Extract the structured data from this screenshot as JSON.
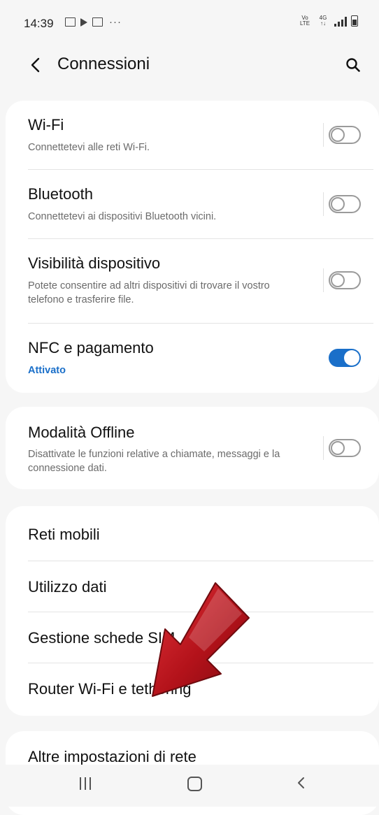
{
  "status_bar": {
    "time": "14:39",
    "dots": "···",
    "lte_label": "VoLTE"
  },
  "header": {
    "title": "Connessioni",
    "back_icon": "chevron-left-icon",
    "search_icon": "search-icon"
  },
  "card1": {
    "items": [
      {
        "title": "Wi-Fi",
        "subtitle": "Connettetevi alle reti Wi-Fi.",
        "toggle": "off"
      },
      {
        "title": "Bluetooth",
        "subtitle": "Connettetevi ai dispositivi Bluetooth vicini.",
        "toggle": "off"
      },
      {
        "title": "Visibilità dispositivo",
        "subtitle": "Potete consentire ad altri dispositivi di trovare il vostro telefono e trasferire file.",
        "toggle": "off"
      },
      {
        "title": "NFC e pagamento",
        "subtitle": "Attivato",
        "toggle": "on"
      }
    ]
  },
  "card2": {
    "items": [
      {
        "title": "Modalità Offline",
        "subtitle": "Disattivate le funzioni relative a chiamate, messaggi e la connessione dati.",
        "toggle": "off"
      }
    ]
  },
  "card3": {
    "items": [
      {
        "title": "Reti mobili"
      },
      {
        "title": "Utilizzo dati"
      },
      {
        "title": "Gestione schede SIM"
      },
      {
        "title": "Router Wi-Fi e tethering"
      }
    ]
  },
  "card4": {
    "items": [
      {
        "title": "Altre impostazioni di rete"
      }
    ]
  },
  "colors": {
    "accent": "#1a6fc9",
    "annotation_arrow": "#c0141b",
    "background": "#f6f6f6",
    "card": "#ffffff"
  },
  "navbar": {
    "recent_icon": "recent-apps-icon",
    "home_icon": "home-icon",
    "back_icon": "back-icon"
  }
}
